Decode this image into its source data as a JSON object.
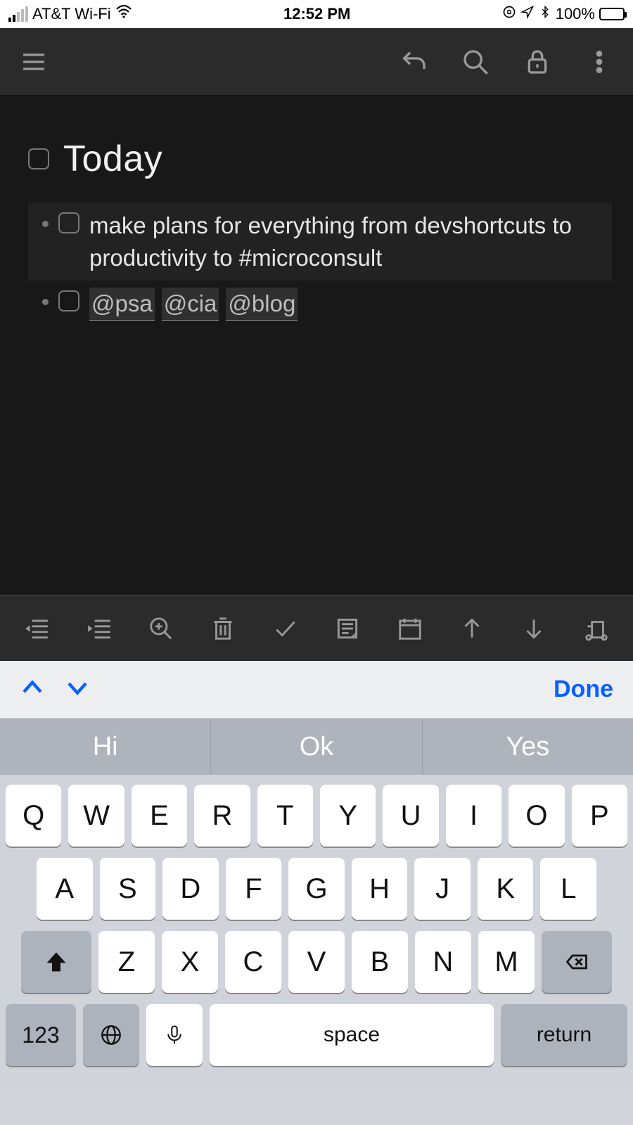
{
  "status": {
    "carrier": "AT&T Wi-Fi",
    "time": "12:52 PM",
    "battery_pct": "100%"
  },
  "note": {
    "title": "Today",
    "tasks": [
      {
        "text": "make plans for everything from devshortcuts to productivity to #microconsult",
        "active": true
      },
      {
        "tags": [
          "@psa",
          "@cia",
          "@blog"
        ]
      }
    ]
  },
  "keyboard": {
    "done_label": "Done",
    "suggestions": [
      "Hi",
      "Ok",
      "Yes"
    ],
    "row1": [
      "Q",
      "W",
      "E",
      "R",
      "T",
      "Y",
      "U",
      "I",
      "O",
      "P"
    ],
    "row2": [
      "A",
      "S",
      "D",
      "F",
      "G",
      "H",
      "J",
      "K",
      "L"
    ],
    "row3": [
      "Z",
      "X",
      "C",
      "V",
      "B",
      "N",
      "M"
    ],
    "num_label": "123",
    "space_label": "space",
    "return_label": "return"
  }
}
